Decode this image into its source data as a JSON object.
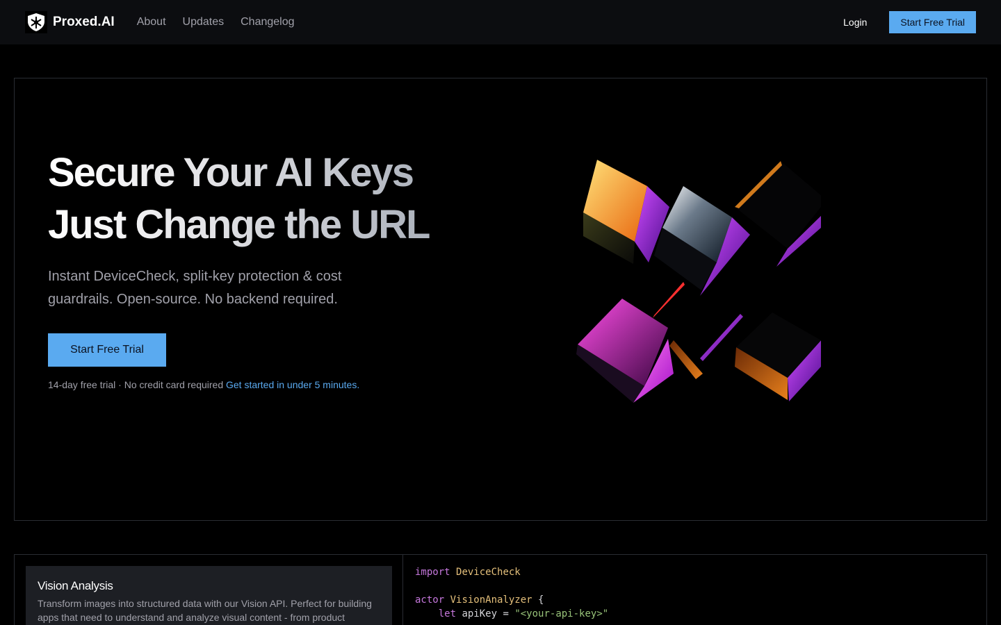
{
  "nav": {
    "brand": "Proxed.AI",
    "links": [
      "About",
      "Updates",
      "Changelog"
    ],
    "login": "Login",
    "cta": "Start Free Trial"
  },
  "hero": {
    "title_line1": "Secure Your AI Keys",
    "title_line2": "Just Change the URL",
    "subtitle": "Instant DeviceCheck, split-key protection & cost guardrails. Open-source. No backend required.",
    "cta": "Start Free Trial",
    "note": "14-day free trial · No credit card required",
    "note_link": "Get started in under 5 minutes."
  },
  "feature": {
    "title": "Vision Analysis",
    "description": "Transform images into structured data with our Vision API. Perfect for building apps that need to understand and analyze visual content - from product",
    "code": {
      "import_kw": "import",
      "import_mod": "DeviceCheck",
      "actor_kw": "actor",
      "actor_name": "VisionAnalyzer",
      "brace": "{",
      "let_kw": "let",
      "api_key_decl": "apiKey =",
      "api_key_val": "\"<your-api-key>\""
    }
  },
  "colors": {
    "accent": "#5aaaf0",
    "nav_bg": "#0c0d10",
    "border": "#2a2d33",
    "card_bg": "#1d1f24"
  }
}
